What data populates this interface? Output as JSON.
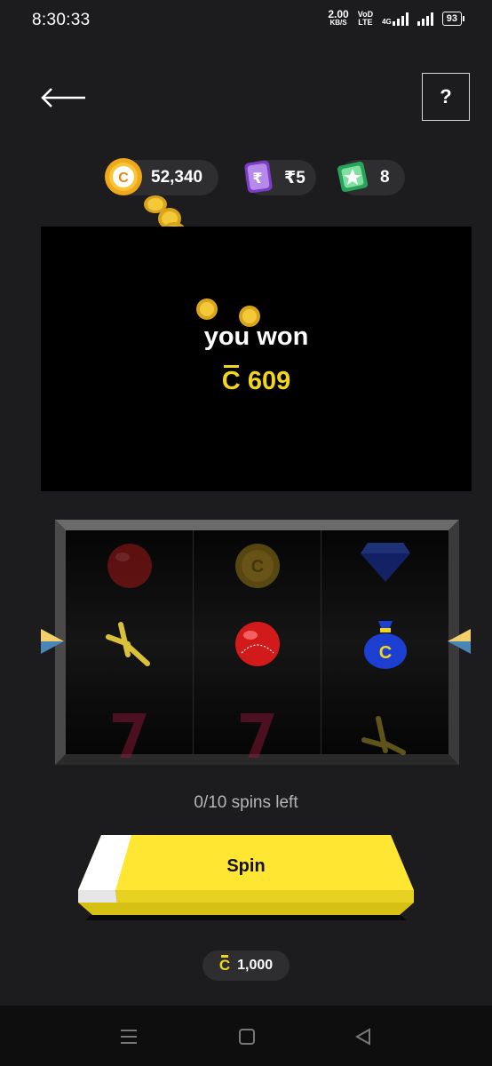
{
  "status_bar": {
    "time": "8:30:33",
    "net_speed": "2.00",
    "net_unit": "KB/S",
    "volte_top": "VoD",
    "volte_bottom": "LTE",
    "network": "4G",
    "battery": "93"
  },
  "header": {
    "back_icon": "arrow-left-icon",
    "help_label": "?"
  },
  "balances": {
    "coins": "52,340",
    "rupee": "₹5",
    "tickets": "8"
  },
  "win": {
    "title": "you won",
    "currency_symbol": "C",
    "amount": "609"
  },
  "reels": [
    [
      "cricket-ball",
      "bat",
      "seven"
    ],
    [
      "coin",
      "cricket-ball",
      "seven"
    ],
    [
      "gem",
      "money-bag",
      "bat"
    ]
  ],
  "spins_left": "0/10 spins left",
  "spin_button": {
    "label": "Spin"
  },
  "spin_cost": {
    "currency_symbol": "C",
    "amount": "1,000"
  },
  "colors": {
    "background": "#1c1c1e",
    "accent_yellow": "#f3d51d",
    "button_yellow": "#ffe633"
  }
}
